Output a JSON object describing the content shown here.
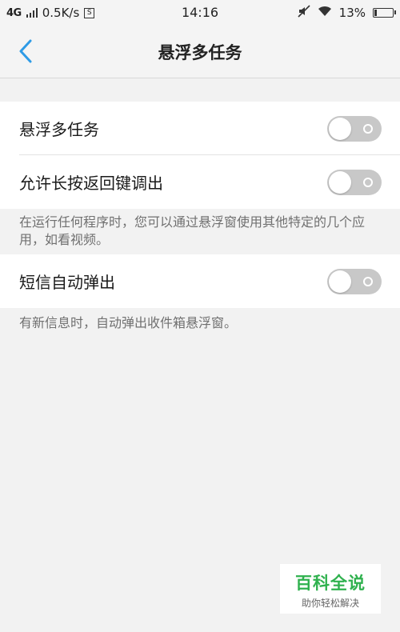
{
  "status_bar": {
    "network": "4G",
    "speed": "0.5K/s",
    "screenshot_glyph": "S",
    "time": "14:16",
    "battery_text": "13%",
    "battery_level": 0.13
  },
  "nav": {
    "title": "悬浮多任务",
    "back_icon": "chevron-left-icon",
    "accent_color": "#2e9be6"
  },
  "settings": {
    "floating_multitask": {
      "label": "悬浮多任务",
      "enabled": false
    },
    "long_press_back": {
      "label": "允许长按返回键调出",
      "enabled": false
    },
    "long_press_hint": "在运行任何程序时，您可以通过悬浮窗使用其他特定的几个应用，如看视频。",
    "sms_popup": {
      "label": "短信自动弹出",
      "enabled": false
    },
    "sms_hint": "有新信息时，自动弹出收件箱悬浮窗。"
  },
  "watermark": {
    "main": "百科全说",
    "sub": "助你轻松解决"
  }
}
